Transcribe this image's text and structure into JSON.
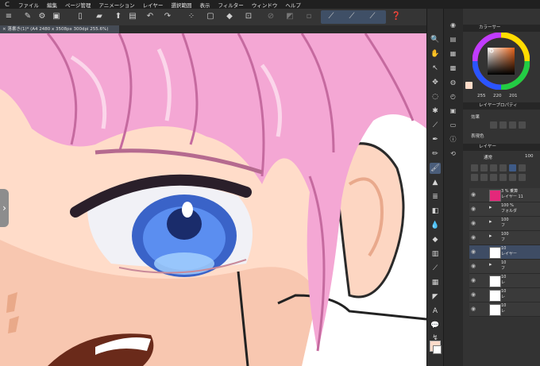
{
  "menu": {
    "items": [
      "ファイル",
      "編集",
      "ページ管理",
      "アニメーション",
      "レイヤー",
      "選択範囲",
      "表示",
      "フィルター",
      "ウィンドウ",
      "ヘルプ"
    ]
  },
  "document": {
    "tab_title": "落書き(1)* (A4 2480 x 3508px 300dpi 255.6%)"
  },
  "color_panel": {
    "title": "カラーサー",
    "rgb_values": [
      "255",
      "220",
      "201"
    ],
    "current_color": "#ffdcc9"
  },
  "layer_property_panel": {
    "title": "レイヤープロパティ",
    "effect_label": "効果",
    "expression_label": "表現色"
  },
  "layer_panel": {
    "title": "レイヤー",
    "blend_mode": "通常",
    "opacity": "100"
  },
  "layers": [
    {
      "line1": "3 % 乗算",
      "line2": "レイヤー 11"
    },
    {
      "line1": "100 %",
      "line2": "フォルダ"
    },
    {
      "line1": "100",
      "line2": "フ"
    },
    {
      "line1": "100",
      "line2": "フ"
    },
    {
      "line1": "10",
      "line2": "レイヤー"
    },
    {
      "line1": "10",
      "line2": "フ"
    },
    {
      "line1": "10",
      "line2": "レ"
    },
    {
      "line1": "10",
      "line2": "レ"
    },
    {
      "line1": "10",
      "line2": "レ"
    }
  ],
  "colors": {
    "app_bg": "#2b2b2b",
    "hair": "#f2a6d2",
    "skin": "#ffdcc9",
    "iris": "#4a7de0",
    "active_tool": "#4a5d7a",
    "layer_thumb_magenta": "#e4287a"
  }
}
